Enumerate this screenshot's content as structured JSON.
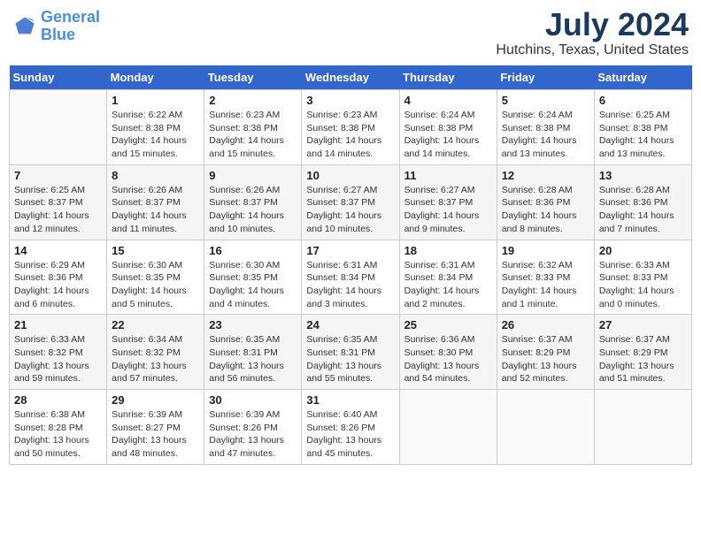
{
  "header": {
    "logo_line1": "General",
    "logo_line2": "Blue",
    "month_year": "July 2024",
    "location": "Hutchins, Texas, United States"
  },
  "days_of_week": [
    "Sunday",
    "Monday",
    "Tuesday",
    "Wednesday",
    "Thursday",
    "Friday",
    "Saturday"
  ],
  "weeks": [
    [
      {
        "num": "",
        "info": ""
      },
      {
        "num": "1",
        "info": "Sunrise: 6:22 AM\nSunset: 8:38 PM\nDaylight: 14 hours\nand 15 minutes."
      },
      {
        "num": "2",
        "info": "Sunrise: 6:23 AM\nSunset: 8:38 PM\nDaylight: 14 hours\nand 15 minutes."
      },
      {
        "num": "3",
        "info": "Sunrise: 6:23 AM\nSunset: 8:38 PM\nDaylight: 14 hours\nand 14 minutes."
      },
      {
        "num": "4",
        "info": "Sunrise: 6:24 AM\nSunset: 8:38 PM\nDaylight: 14 hours\nand 14 minutes."
      },
      {
        "num": "5",
        "info": "Sunrise: 6:24 AM\nSunset: 8:38 PM\nDaylight: 14 hours\nand 13 minutes."
      },
      {
        "num": "6",
        "info": "Sunrise: 6:25 AM\nSunset: 8:38 PM\nDaylight: 14 hours\nand 13 minutes."
      }
    ],
    [
      {
        "num": "7",
        "info": "Sunrise: 6:25 AM\nSunset: 8:37 PM\nDaylight: 14 hours\nand 12 minutes."
      },
      {
        "num": "8",
        "info": "Sunrise: 6:26 AM\nSunset: 8:37 PM\nDaylight: 14 hours\nand 11 minutes."
      },
      {
        "num": "9",
        "info": "Sunrise: 6:26 AM\nSunset: 8:37 PM\nDaylight: 14 hours\nand 10 minutes."
      },
      {
        "num": "10",
        "info": "Sunrise: 6:27 AM\nSunset: 8:37 PM\nDaylight: 14 hours\nand 10 minutes."
      },
      {
        "num": "11",
        "info": "Sunrise: 6:27 AM\nSunset: 8:37 PM\nDaylight: 14 hours\nand 9 minutes."
      },
      {
        "num": "12",
        "info": "Sunrise: 6:28 AM\nSunset: 8:36 PM\nDaylight: 14 hours\nand 8 minutes."
      },
      {
        "num": "13",
        "info": "Sunrise: 6:28 AM\nSunset: 8:36 PM\nDaylight: 14 hours\nand 7 minutes."
      }
    ],
    [
      {
        "num": "14",
        "info": "Sunrise: 6:29 AM\nSunset: 8:36 PM\nDaylight: 14 hours\nand 6 minutes."
      },
      {
        "num": "15",
        "info": "Sunrise: 6:30 AM\nSunset: 8:35 PM\nDaylight: 14 hours\nand 5 minutes."
      },
      {
        "num": "16",
        "info": "Sunrise: 6:30 AM\nSunset: 8:35 PM\nDaylight: 14 hours\nand 4 minutes."
      },
      {
        "num": "17",
        "info": "Sunrise: 6:31 AM\nSunset: 8:34 PM\nDaylight: 14 hours\nand 3 minutes."
      },
      {
        "num": "18",
        "info": "Sunrise: 6:31 AM\nSunset: 8:34 PM\nDaylight: 14 hours\nand 2 minutes."
      },
      {
        "num": "19",
        "info": "Sunrise: 6:32 AM\nSunset: 8:33 PM\nDaylight: 14 hours\nand 1 minute."
      },
      {
        "num": "20",
        "info": "Sunrise: 6:33 AM\nSunset: 8:33 PM\nDaylight: 14 hours\nand 0 minutes."
      }
    ],
    [
      {
        "num": "21",
        "info": "Sunrise: 6:33 AM\nSunset: 8:32 PM\nDaylight: 13 hours\nand 59 minutes."
      },
      {
        "num": "22",
        "info": "Sunrise: 6:34 AM\nSunset: 8:32 PM\nDaylight: 13 hours\nand 57 minutes."
      },
      {
        "num": "23",
        "info": "Sunrise: 6:35 AM\nSunset: 8:31 PM\nDaylight: 13 hours\nand 56 minutes."
      },
      {
        "num": "24",
        "info": "Sunrise: 6:35 AM\nSunset: 8:31 PM\nDaylight: 13 hours\nand 55 minutes."
      },
      {
        "num": "25",
        "info": "Sunrise: 6:36 AM\nSunset: 8:30 PM\nDaylight: 13 hours\nand 54 minutes."
      },
      {
        "num": "26",
        "info": "Sunrise: 6:37 AM\nSunset: 8:29 PM\nDaylight: 13 hours\nand 52 minutes."
      },
      {
        "num": "27",
        "info": "Sunrise: 6:37 AM\nSunset: 8:29 PM\nDaylight: 13 hours\nand 51 minutes."
      }
    ],
    [
      {
        "num": "28",
        "info": "Sunrise: 6:38 AM\nSunset: 8:28 PM\nDaylight: 13 hours\nand 50 minutes."
      },
      {
        "num": "29",
        "info": "Sunrise: 6:39 AM\nSunset: 8:27 PM\nDaylight: 13 hours\nand 48 minutes."
      },
      {
        "num": "30",
        "info": "Sunrise: 6:39 AM\nSunset: 8:26 PM\nDaylight: 13 hours\nand 47 minutes."
      },
      {
        "num": "31",
        "info": "Sunrise: 6:40 AM\nSunset: 8:26 PM\nDaylight: 13 hours\nand 45 minutes."
      },
      {
        "num": "",
        "info": ""
      },
      {
        "num": "",
        "info": ""
      },
      {
        "num": "",
        "info": ""
      }
    ]
  ]
}
